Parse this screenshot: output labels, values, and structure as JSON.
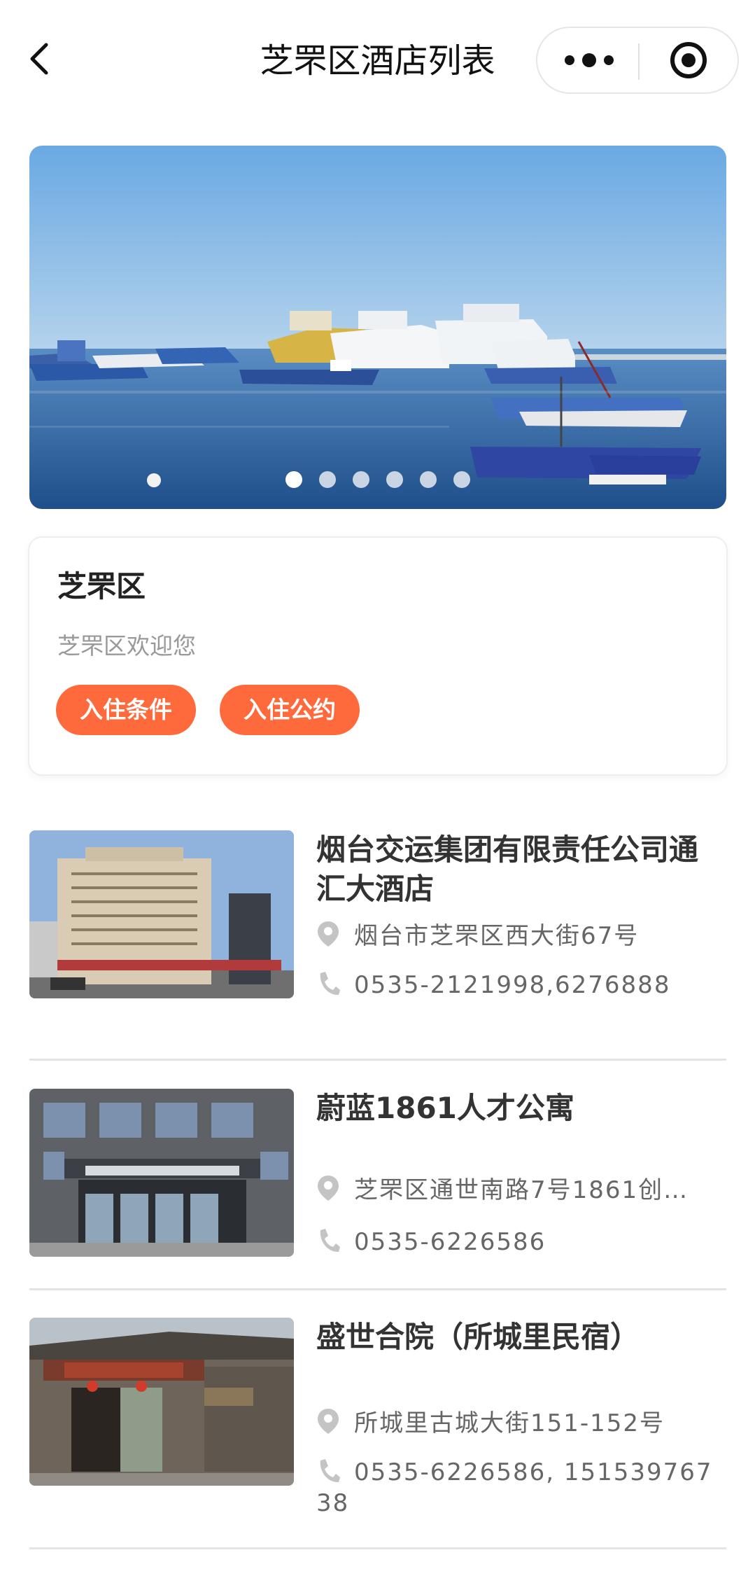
{
  "nav": {
    "title": "芝罘区酒店列表",
    "back_icon": "chevron-left-icon",
    "more_icon": "more-dots-icon",
    "close_icon": "target-close-icon"
  },
  "banner": {
    "dot_count": 6,
    "active_dot": 0
  },
  "district": {
    "name": "芝罘区",
    "welcome": "芝罘区欢迎您",
    "buttons": [
      "入住条件",
      "入住公约"
    ],
    "accent": "#ff6a3d"
  },
  "hotels": [
    {
      "name": "烟台交运集团有限责任公司通汇大酒店",
      "address": "烟台市芝罘区西大街67号",
      "phone": "0535-2121998,6276888"
    },
    {
      "name": "蔚蓝1861人才公寓",
      "address": "芝罘区通世南路7号1861创…",
      "phone": "0535-6226586"
    },
    {
      "name": "盛世合院（所城里民宿）",
      "address": "所城里古城大街151-152号",
      "phone": "0535-6226586, 15153976738"
    }
  ],
  "icons": {
    "location": "location-pin-icon",
    "phone": "phone-icon"
  }
}
